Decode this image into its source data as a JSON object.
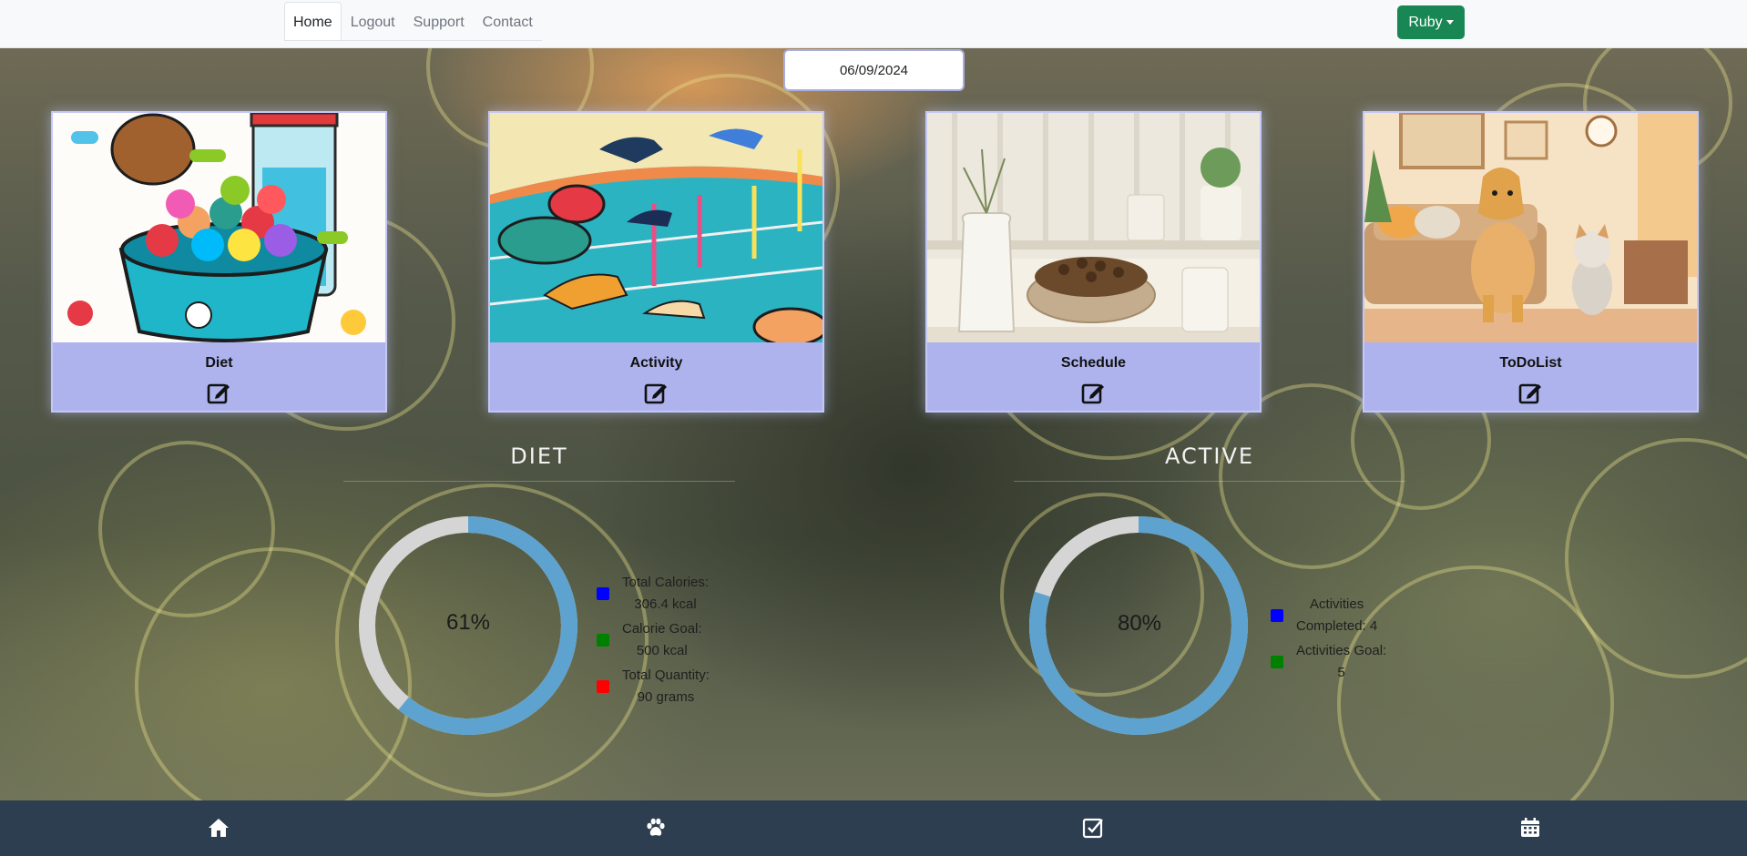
{
  "nav": {
    "tabs": [
      {
        "label": "Home",
        "active": true
      },
      {
        "label": "Logout"
      },
      {
        "label": "Support"
      },
      {
        "label": "Contact"
      }
    ],
    "user_button": "Ruby"
  },
  "date": "06/09/2024",
  "cards": [
    {
      "title": "Diet",
      "image_icon": "food-bowl-illustration",
      "action_icon": "edit-icon"
    },
    {
      "title": "Activity",
      "image_icon": "dog-agility-illustration",
      "action_icon": "edit-icon"
    },
    {
      "title": "Schedule",
      "image_icon": "kitchen-pet-bowl-illustration",
      "action_icon": "edit-icon"
    },
    {
      "title": "ToDoList",
      "image_icon": "dog-and-cat-livingroom-illustration",
      "action_icon": "edit-icon"
    }
  ],
  "diet": {
    "title": "DIET",
    "percent_label": "61%",
    "percent": 61,
    "legend": [
      {
        "text": "Total Calories: 306.4 kcal",
        "line1": "Total Calories:",
        "line2": "306.4 kcal",
        "color": "#0000ff"
      },
      {
        "text": "Calorie Goal: 500 kcal",
        "line1": "Calorie Goal:",
        "line2": "500 kcal",
        "color": "#008000"
      },
      {
        "text": "Total Quantity: 90 grams",
        "line1": "Total Quantity:",
        "line2": "90 grams",
        "color": "#ff0000"
      }
    ]
  },
  "active": {
    "title": "ACTIVE",
    "percent_label": "80%",
    "percent": 80,
    "legend": [
      {
        "text": "Activities Completed: 4",
        "line1": "Activities",
        "line2": "Completed: 4",
        "color": "#0000ff"
      },
      {
        "text": "Activities Goal: 5",
        "line1": "Activities Goal:",
        "line2": "5",
        "color": "#008000"
      }
    ]
  },
  "colors": {
    "donut_fill": "#5ea3cf",
    "donut_track": "#d5d5d5",
    "bottom_bar": "#2c3e50",
    "card_bg": "#aeb3ee",
    "user_button": "#198754"
  },
  "bottom_nav": [
    "home-icon",
    "paw-icon",
    "checkbox-icon",
    "calendar-icon"
  ]
}
